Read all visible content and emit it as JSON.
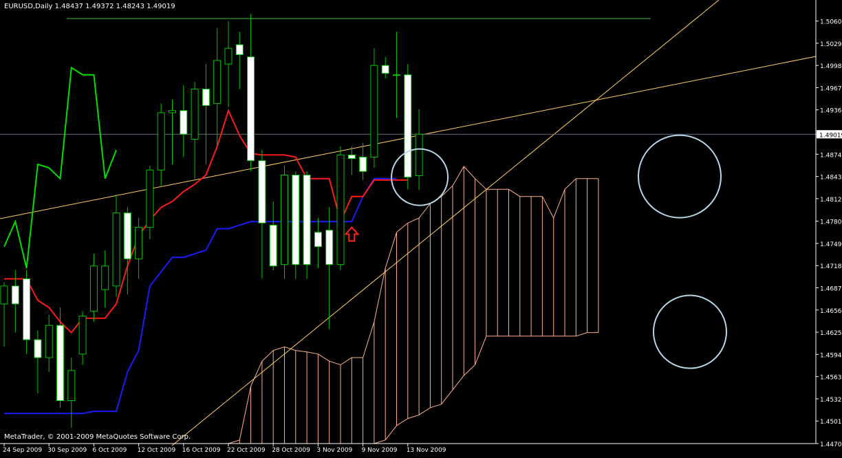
{
  "header": {
    "symbol_line": "EURUSD,Daily  1.48437 1.49372 1.48243 1.49019"
  },
  "footer": {
    "copyright": "MetaTrader, © 2001-2009 MetaQuotes Software Corp."
  },
  "chart_data": {
    "type": "candlestick",
    "ylim": [
      1.447,
      1.5075
    ],
    "current_price": "1.49019",
    "y_ticks": [
      "1.50600",
      "1.50290",
      "1.49980",
      "1.49670",
      "1.49360",
      "1.49019",
      "1.48740",
      "1.48430",
      "1.48120",
      "1.47805",
      "1.47495",
      "1.47185",
      "1.46875",
      "1.46565",
      "1.46255",
      "1.45945",
      "1.45635",
      "1.45325",
      "1.45015",
      "1.44700"
    ],
    "x_ticks": [
      {
        "label": "24 Sep 2009",
        "i": 0
      },
      {
        "label": "30 Sep 2009",
        "i": 4
      },
      {
        "label": "6 Oct 2009",
        "i": 8
      },
      {
        "label": "12 Oct 2009",
        "i": 12
      },
      {
        "label": "16 Oct 2009",
        "i": 16
      },
      {
        "label": "22 Oct 2009",
        "i": 20
      },
      {
        "label": "28 Oct 2009",
        "i": 24
      },
      {
        "label": "3 Nov 2009",
        "i": 28
      },
      {
        "label": "9 Nov 2009",
        "i": 32
      },
      {
        "label": "13 Nov 2009",
        "i": 36
      }
    ],
    "candles": [
      {
        "o": 1.4665,
        "h": 1.4695,
        "l": 1.4605,
        "c": 1.469
      },
      {
        "o": 1.469,
        "h": 1.4712,
        "l": 1.4625,
        "c": 1.4665
      },
      {
        "o": 1.47,
        "h": 1.4712,
        "l": 1.4595,
        "c": 1.4615
      },
      {
        "o": 1.4615,
        "h": 1.4628,
        "l": 1.454,
        "c": 1.459
      },
      {
        "o": 1.459,
        "h": 1.465,
        "l": 1.457,
        "c": 1.4635
      },
      {
        "o": 1.4635,
        "h": 1.466,
        "l": 1.452,
        "c": 1.453
      },
      {
        "o": 1.453,
        "h": 1.459,
        "l": 1.4492,
        "c": 1.4572
      },
      {
        "o": 1.4595,
        "h": 1.4655,
        "l": 1.458,
        "c": 1.4648
      },
      {
        "o": 1.4655,
        "h": 1.4735,
        "l": 1.464,
        "c": 1.4718
      },
      {
        "o": 1.4685,
        "h": 1.474,
        "l": 1.466,
        "c": 1.4718
      },
      {
        "o": 1.469,
        "h": 1.4818,
        "l": 1.4675,
        "c": 1.4792
      },
      {
        "o": 1.4792,
        "h": 1.48,
        "l": 1.4678,
        "c": 1.4728
      },
      {
        "o": 1.4728,
        "h": 1.4785,
        "l": 1.47,
        "c": 1.4772
      },
      {
        "o": 1.4772,
        "h": 1.4858,
        "l": 1.4755,
        "c": 1.4852
      },
      {
        "o": 1.4852,
        "h": 1.4945,
        "l": 1.483,
        "c": 1.4932
      },
      {
        "o": 1.4932,
        "h": 1.495,
        "l": 1.486,
        "c": 1.4935
      },
      {
        "o": 1.4935,
        "h": 1.497,
        "l": 1.487,
        "c": 1.4902
      },
      {
        "o": 1.4895,
        "h": 1.4975,
        "l": 1.484,
        "c": 1.4965
      },
      {
        "o": 1.4965,
        "h": 1.5,
        "l": 1.486,
        "c": 1.4942
      },
      {
        "o": 1.4945,
        "h": 1.505,
        "l": 1.4885,
        "c": 1.5005
      },
      {
        "o": 1.5,
        "h": 1.506,
        "l": 1.494,
        "c": 1.5022
      },
      {
        "o": 1.5027,
        "h": 1.5045,
        "l": 1.4965,
        "c": 1.5013
      },
      {
        "o": 1.501,
        "h": 1.507,
        "l": 1.485,
        "c": 1.4865
      },
      {
        "o": 1.4865,
        "h": 1.488,
        "l": 1.47,
        "c": 1.4778
      },
      {
        "o": 1.4775,
        "h": 1.4808,
        "l": 1.4712,
        "c": 1.4718
      },
      {
        "o": 1.472,
        "h": 1.4858,
        "l": 1.47,
        "c": 1.4845
      },
      {
        "o": 1.4845,
        "h": 1.485,
        "l": 1.47,
        "c": 1.472
      },
      {
        "o": 1.4845,
        "h": 1.485,
        "l": 1.47,
        "c": 1.472
      },
      {
        "o": 1.4765,
        "h": 1.4785,
        "l": 1.4715,
        "c": 1.4745
      },
      {
        "o": 1.4768,
        "h": 1.48,
        "l": 1.463,
        "c": 1.472
      },
      {
        "o": 1.472,
        "h": 1.4885,
        "l": 1.4712,
        "c": 1.4873
      },
      {
        "o": 1.4873,
        "h": 1.4885,
        "l": 1.4845,
        "c": 1.4868
      },
      {
        "o": 1.487,
        "h": 1.489,
        "l": 1.4838,
        "c": 1.485
      },
      {
        "o": 1.487,
        "h": 1.5022,
        "l": 1.4855,
        "c": 1.4998
      },
      {
        "o": 1.4998,
        "h": 1.501,
        "l": 1.498,
        "c": 1.4987
      },
      {
        "o": 1.4985,
        "h": 1.5045,
        "l": 1.4925,
        "c": 1.4985
      },
      {
        "o": 1.4985,
        "h": 1.5,
        "l": 1.4825,
        "c": 1.4842
      },
      {
        "o": 1.4844,
        "h": 1.4937,
        "l": 1.4824,
        "c": 1.4902
      }
    ],
    "tenkan_red": [
      1.47,
      1.47,
      1.47,
      1.467,
      1.466,
      1.464,
      1.4625,
      1.4645,
      1.4645,
      1.4645,
      1.4665,
      1.4718,
      1.476,
      1.4782,
      1.48,
      1.4808,
      1.4822,
      1.4832,
      1.4845,
      1.4885,
      1.4935,
      1.49,
      1.4875,
      1.4873,
      1.4873,
      1.4873,
      1.487,
      1.484,
      1.484,
      1.484,
      1.478,
      1.4815,
      1.4815,
      1.4838,
      1.4838,
      1.4838,
      1.4838
    ],
    "kijun_blue": [
      1.4512,
      1.4512,
      1.4512,
      1.4512,
      1.4512,
      1.4512,
      1.4512,
      1.4512,
      1.4515,
      1.4515,
      1.4515,
      1.457,
      1.46,
      1.469,
      1.471,
      1.473,
      1.473,
      1.4735,
      1.474,
      1.477,
      1.477,
      1.4775,
      1.478,
      1.478,
      1.478,
      1.478,
      1.478,
      1.478,
      1.478,
      1.478,
      1.478,
      1.478,
      1.4815,
      1.484,
      1.484,
      1.484
    ],
    "chikou_green": [
      1.4745,
      1.478,
      1.4715,
      1.486,
      1.4855,
      1.484,
      1.4995,
      1.4985,
      1.4985,
      1.484,
      1.488
    ],
    "cloud_upper": [
      1.447,
      1.447,
      1.447,
      1.447,
      1.447,
      1.447,
      1.447,
      1.447,
      1.447,
      1.447,
      1.447,
      1.447,
      1.447,
      1.447,
      1.447,
      1.447,
      1.447,
      1.447,
      1.447,
      1.447,
      1.447,
      1.4475,
      1.455,
      1.4585,
      1.46,
      1.4605,
      1.46,
      1.4598,
      1.4595,
      1.4585,
      1.458,
      1.459,
      1.459,
      1.464,
      1.4715,
      1.4765,
      1.4778,
      1.4785,
      1.4805,
      1.4815,
      1.483,
      1.4857,
      1.484,
      1.4825,
      1.4825,
      1.4825,
      1.4815,
      1.4815,
      1.4815,
      1.4785,
      1.4825,
      1.484,
      1.484,
      1.484
    ],
    "cloud_lower": [
      1.447,
      1.447,
      1.447,
      1.447,
      1.447,
      1.447,
      1.447,
      1.447,
      1.447,
      1.447,
      1.447,
      1.447,
      1.447,
      1.447,
      1.447,
      1.447,
      1.447,
      1.447,
      1.447,
      1.447,
      1.447,
      1.447,
      1.447,
      1.447,
      1.447,
      1.447,
      1.447,
      1.447,
      1.447,
      1.447,
      1.447,
      1.447,
      1.447,
      1.447,
      1.4475,
      1.4495,
      1.4505,
      1.451,
      1.452,
      1.4525,
      1.4545,
      1.4565,
      1.458,
      1.462,
      1.462,
      1.462,
      1.462,
      1.462,
      1.462,
      1.462,
      1.462,
      1.462,
      1.4625,
      1.4625
    ],
    "hline_green": 1.50635,
    "colors": {
      "bull_body": "#000000",
      "bear_body": "#ffffff",
      "candle_outline": "#00c800",
      "tenkan": "#ff1a1a",
      "kijun": "#1a1aff",
      "chikou": "#00e000",
      "cloud": "#ffb090",
      "trendline": "#ffd060",
      "circle": "#b8d8e8",
      "arrow": "#ff2020",
      "axis": "#ffffff",
      "price_line": "#607080"
    }
  }
}
